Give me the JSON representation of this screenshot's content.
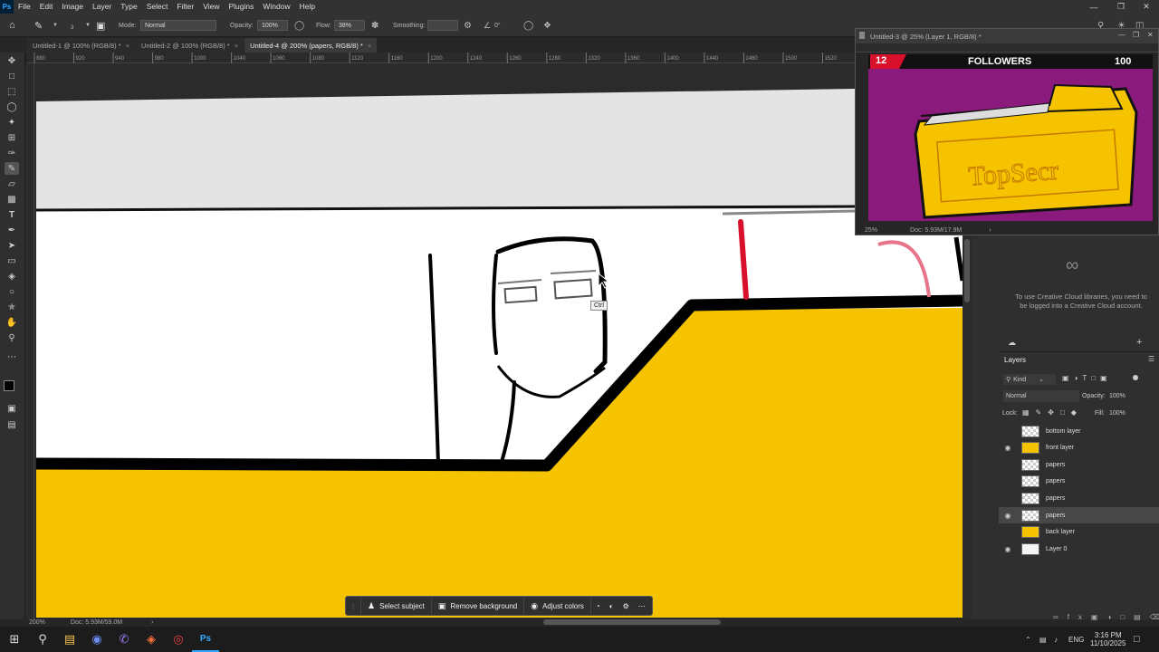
{
  "menubar": {
    "logo": "Ps",
    "items": [
      "File",
      "Edit",
      "Image",
      "Layer",
      "Type",
      "Select",
      "Filter",
      "View",
      "Plugins",
      "Window",
      "Help"
    ]
  },
  "options": {
    "brush_size": "3",
    "mode_label": "Mode:",
    "mode_value": "Normal",
    "opacity_label": "Opacity:",
    "opacity_value": "100%",
    "flow_label": "Flow:",
    "flow_value": "38%",
    "smoothing_label": "Smoothing:",
    "angle_value": "0°"
  },
  "tabs": [
    {
      "label": "Untitled-1 @ 100% (RGB/8) *"
    },
    {
      "label": "Untitled-2 @ 100% (RGB/8) *"
    },
    {
      "label": "Untitled-4 @ 200% (papers, RGB/8) *"
    }
  ],
  "ruler_ticks": [
    "880",
    "920",
    "940",
    "980",
    "1000",
    "1040",
    "1060",
    "1080",
    "1120",
    "1160",
    "1200",
    "1240",
    "1260",
    "1280",
    "1320",
    "1360",
    "1400",
    "1440",
    "1460",
    "1500",
    "1520"
  ],
  "canvas": {
    "tooltip": "Ctrl"
  },
  "status": {
    "zoom": "200%",
    "doc": "Doc: 5.93M/59.0M"
  },
  "context_bar": {
    "select_subject": "Select subject",
    "remove_background": "Remove background",
    "adjust_colors": "Adjust colors"
  },
  "float_window": {
    "title": "Untitled-3 @ 25% (Layer 1, RGB/8) *",
    "badge_number": "12",
    "followers_label": "FOLLOWERS",
    "followers_count": "100",
    "zoom": "25%",
    "doc": "Doc: 5.93M/17.9M"
  },
  "libraries": {
    "message": "To use Creative Cloud libraries, you need to be logged into a Creative Cloud account."
  },
  "layers": {
    "panel_title": "Layers",
    "kind_label": "Kind",
    "blend_mode": "Normal",
    "opacity_label": "Opacity:",
    "opacity_value": "100%",
    "lock_label": "Lock:",
    "fill_label": "Fill:",
    "fill_value": "100%",
    "items": [
      {
        "name": "bottom layer",
        "visible": false,
        "thumb": "trans"
      },
      {
        "name": "front layer",
        "visible": true,
        "thumb": "yellow"
      },
      {
        "name": "papers",
        "visible": false,
        "thumb": "trans"
      },
      {
        "name": "papers",
        "visible": false,
        "thumb": "trans"
      },
      {
        "name": "papers",
        "visible": false,
        "thumb": "trans"
      },
      {
        "name": "papers",
        "visible": true,
        "thumb": "trans",
        "selected": true
      },
      {
        "name": "back layer",
        "visible": false,
        "thumb": "yellow"
      },
      {
        "name": "Layer 0",
        "visible": true,
        "thumb": "white"
      }
    ]
  },
  "taskbar": {
    "lang": "ENG",
    "time": "3:16 PM",
    "date": "11/10/2025"
  },
  "colors": {
    "yellow": "#f5c300",
    "magenta": "#8a1a7c",
    "red": "#d8102c",
    "ui_dark": "#262626"
  }
}
